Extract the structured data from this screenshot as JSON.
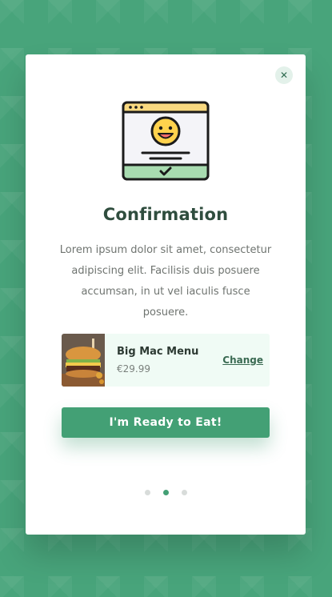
{
  "modal": {
    "close_icon": "close-icon",
    "close_glyph": "✕",
    "illustration_icon": "browser-smiley-checkmark-icon",
    "title": "Confirmation",
    "body": "Lorem ipsum dolor sit amet, consectetur adipiscing elit. Facilisis duis posuere accumsan, in ut vel iaculis fusce posuere."
  },
  "product": {
    "image_icon": "burger-photo",
    "name": "Big Mac Menu",
    "price": "€29.99",
    "change_label": "Change"
  },
  "cta": {
    "label": "I'm Ready to Eat!"
  },
  "pager": {
    "total": 3,
    "active_index": 1
  },
  "colors": {
    "background": "#48a47b",
    "accent": "#43a075",
    "card_bg": "#f0fbf5",
    "title": "#2f4d3e"
  }
}
